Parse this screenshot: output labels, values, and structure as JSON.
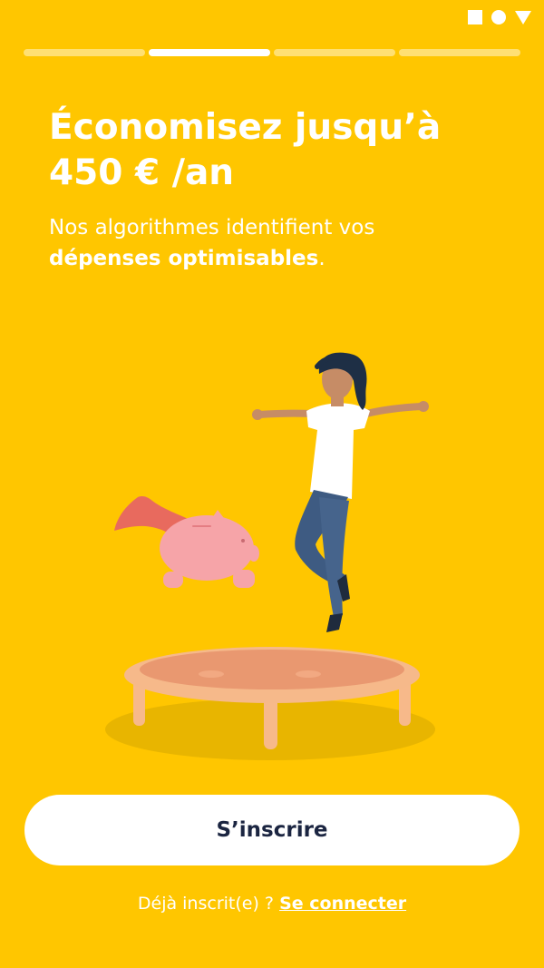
{
  "status_bar": {
    "icons": [
      "square-icon",
      "circle-icon",
      "triangle-icon"
    ]
  },
  "progress": {
    "total_steps": 4,
    "current_step": 2
  },
  "headline": {
    "line1": "Économisez jusqu’à",
    "line2": "450 € /an"
  },
  "description": {
    "line1": "Nos algorithmes identifient vos",
    "highlight": "dépenses optimisables",
    "suffix": "."
  },
  "actions": {
    "signup_label": "S’inscrire",
    "login_prompt": "Déjà inscrit(e) ?",
    "login_link": "Se connecter"
  },
  "colors": {
    "background": "#FFC600",
    "button_text": "#1B2541",
    "text": "#FFFFFF"
  }
}
